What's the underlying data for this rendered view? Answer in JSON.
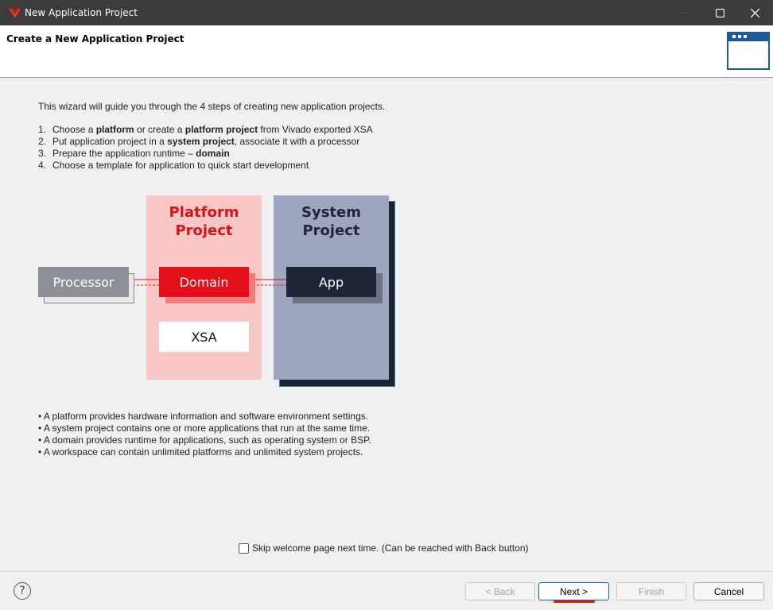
{
  "window": {
    "title": "New Application Project",
    "minimize_icon": "minimize-icon",
    "maximize_icon": "maximize-icon",
    "close_icon": "close-icon"
  },
  "header": {
    "heading": "Create a New Application Project",
    "icon": "wizard-window-icon"
  },
  "content": {
    "intro": "This wizard will guide you through the 4 steps of creating new application projects.",
    "steps": [
      {
        "num": "1.",
        "parts": [
          "Choose a ",
          "platform",
          " or create a ",
          "platform project",
          " from Vivado exported XSA"
        ]
      },
      {
        "num": "2.",
        "parts": [
          "Put application project in a ",
          "system project",
          ", associate it with a processor"
        ]
      },
      {
        "num": "3.",
        "parts": [
          "Prepare the application runtime – ",
          "domain"
        ]
      },
      {
        "num": "4.",
        "parts": [
          "Choose a template for application to quick start development"
        ]
      }
    ],
    "diagram": {
      "platform_project_line1": "Platform",
      "platform_project_line2": "Project",
      "system_project_line1": "System",
      "system_project_line2": "Project",
      "processor": "Processor",
      "domain": "Domain",
      "app": "App",
      "xsa": "XSA",
      "colors": {
        "platform_bg": "#f9c6c6",
        "platform_red": "#e3101b",
        "system_bg": "#9ea5bf",
        "system_dark": "#1e2535",
        "processor_gray": "#8e9097"
      }
    },
    "bullets": [
      "• A platform provides hardware information and software environment settings.",
      "• A system project contains one or more applications that run at the same time.",
      "• A domain provides runtime for applications, such as operating system or BSP.",
      "• A workspace can contain unlimited platforms and unlimited system projects."
    ],
    "skip_checkbox": {
      "label": "Skip welcome page next time. (Can be reached with Back button)",
      "checked": false
    }
  },
  "footer": {
    "help": "?",
    "back": "< Back",
    "next": "Next >",
    "finish": "Finish",
    "cancel": "Cancel"
  }
}
